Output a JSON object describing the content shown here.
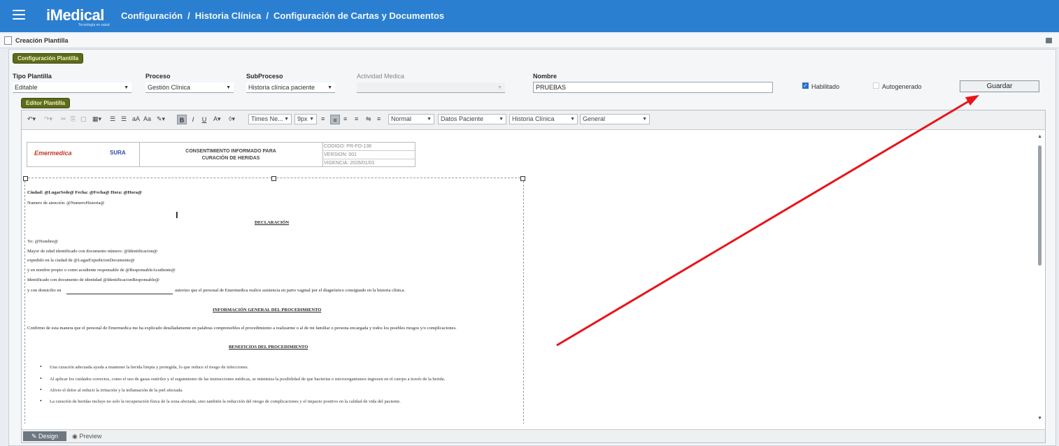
{
  "app": {
    "logo": "iMedical",
    "logo_tagline": "Tecnología en salud",
    "breadcrumb": [
      "Configuración",
      "Historia Clínica",
      "Configuración de Cartas y Documentos"
    ]
  },
  "panel": {
    "title": "Creación Plantilla"
  },
  "config_section": {
    "tag": "Configuración Plantilla",
    "fields": {
      "tipo_plantilla": {
        "label": "Tipo Plantilla",
        "value": "Editable"
      },
      "proceso": {
        "label": "Proceso",
        "value": "Gestión Clínica"
      },
      "subproceso": {
        "label": "SubProceso",
        "value": "Historia clínica paciente"
      },
      "actividad_medica": {
        "label": "Actividad Medica",
        "value": ""
      },
      "nombre": {
        "label": "Nombre",
        "value": "PRUEBAS"
      }
    },
    "habilitado": {
      "label": "Habilitado",
      "checked": true
    },
    "autogenerado": {
      "label": "Autogenerado",
      "checked": false
    },
    "guardar_label": "Guardar"
  },
  "editor_section": {
    "tag": "Editor Plantilla",
    "toolbar": {
      "font_name": "Times Ne...",
      "font_size": "9px",
      "paragraph": "Normal",
      "datos_paciente": "Datos Paciente",
      "historia_clinica": "Historia Clínica",
      "general": "General"
    },
    "tabs": {
      "design": "Design",
      "preview": "Preview"
    }
  },
  "document": {
    "header": {
      "brand": "Emermedica",
      "brand2": "SURA",
      "title_line1": "CONSENTIMIENTO INFORMADO PARA",
      "title_line2": "CURACIÓN DE HERIDAS",
      "codigo": "CODIGO: PR-FO-138",
      "version": "VERSION: 001",
      "vigencia": "VIGENCIA: 2026/01/01"
    },
    "line_ciudad": "Ciudad: @LugarSede@ Fecha: @Fecha@  Hora: @Hora@",
    "line_atencion": "Numero de atención: @NumeroHistoria@",
    "heading_declaracion": "DECLARACIÓN",
    "line_yo": "Yo: @Nombre@",
    "line_mayor": "Mayor de edad identificado con documento número: @Identificacion@",
    "line_expedido": "expedido en la ciudad de @LugarExpedicionDocumento@",
    "line_nombre_propio": "y en nombre propio o como acudiente responsable de @ResponsableAcudiente@",
    "line_identificado": "Identificado con documento de identidad @IdentificacionResponsable@",
    "line_domicilio_a": "y con domicilio en",
    "line_domicilio_b": "autorizo que el personal de Emermedica realice asistencia en parto vaginal por el diagnóstico consignado en la historia clínica.",
    "heading_info": "INFORMACIÓN GENERAL DEL PROCEDIMIENTO",
    "line_confirmo": "Confirmo de esta manera que el personal de Emermedica me ha explicado detalladamente en palabras comprensibles el procedimiento a realizarme o al de mi familiar o persona encargada y todos los posibles riesgos y/o complicaciones.",
    "heading_beneficios": "BENEFICIOS DEL PROCEDIMIENTO",
    "bullets": [
      "Una curación adecuada ayuda a mantener la herida limpia y protegida, lo que reduce el riesgo de infecciones.",
      "Al aplicar los cuidados correctos, como el uso de gasas estériles y el seguimiento de las instrucciones médicas, se minimiza la posibilidad de que bacterias o microorganismos ingresen en el cuerpo a través de la herida.",
      "Alivio el dolor al reducir la irritación y la inflamación de la piel afectada.",
      "La curación de heridas incluye no solo la recuperación física de la zona afectada, sino también la reducción del riesgo de complicaciones y el impacto positivo en la calidad de vida del paciente."
    ]
  }
}
